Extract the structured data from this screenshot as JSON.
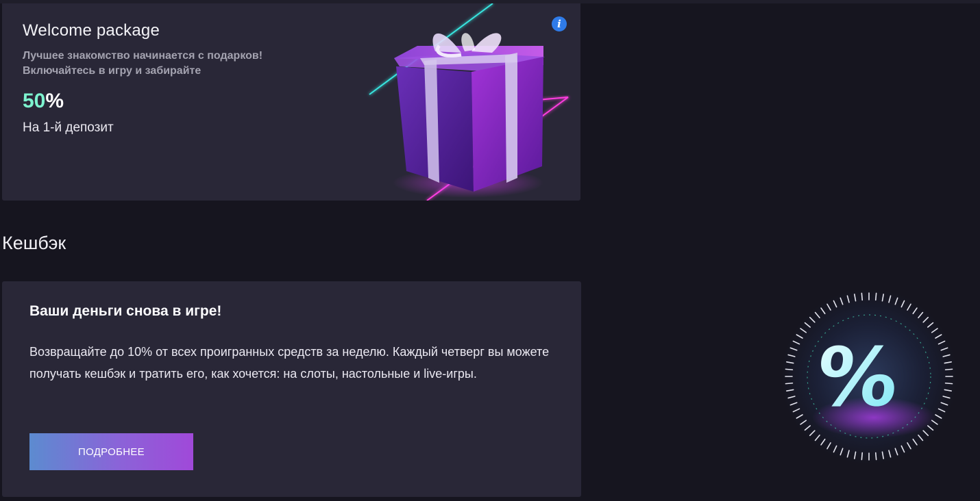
{
  "welcome": {
    "title": "Welcome package",
    "subtitle_line1": "Лучшее знакомство начинается с подарков!",
    "subtitle_line2": "Включайтесь в игру и забирайте",
    "percent_value": "50",
    "percent_sign": "%",
    "deposit_text": "На 1-й депозит",
    "info_icon_glyph": "i",
    "art_icon": "gift-box-icon"
  },
  "cashback": {
    "section_title": "Кешбэк",
    "card_title": "Ваши деньги снова в игре!",
    "description": "Возвращайте до 10% от всех проигранных средств за неделю. Каждый четверг вы можете получать кешбэк и тратить его, как хочется: на слоты, настольные и live-игры.",
    "button_label": "ПОДРОБНЕЕ",
    "art_icon": "percent-dial-icon",
    "art_glyph": "%"
  },
  "colors": {
    "page_bg": "#16151f",
    "card_bg": "#292737",
    "accent_mint": "#7df3cf",
    "info_blue": "#2f7be8",
    "button_gradient_start": "#5c8bd0",
    "button_gradient_end": "#a049d9"
  }
}
